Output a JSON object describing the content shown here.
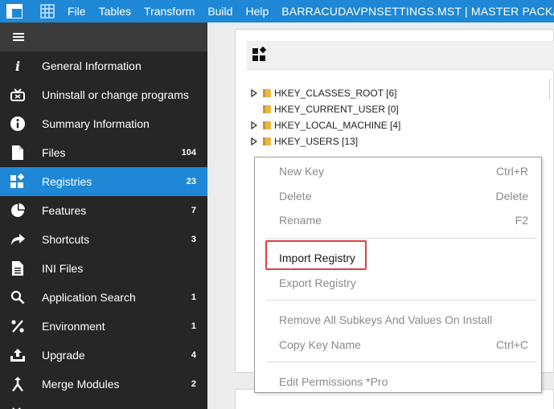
{
  "titlebar": {
    "menu": [
      "File",
      "Tables",
      "Transform",
      "Build",
      "Help"
    ],
    "title": "BARRACUDAVPNSETTINGS.MST | MASTER PACKAG"
  },
  "sidebar": {
    "items": [
      {
        "icon": "info-icon",
        "label": "General Information",
        "count": ""
      },
      {
        "icon": "uninstall-icon",
        "label": "Uninstall or change programs",
        "count": ""
      },
      {
        "icon": "summary-info-icon",
        "label": "Summary Information",
        "count": ""
      },
      {
        "icon": "file-icon",
        "label": "Files",
        "count": "104"
      },
      {
        "icon": "registry-icon",
        "label": "Registries",
        "count": "23"
      },
      {
        "icon": "features-icon",
        "label": "Features",
        "count": "7"
      },
      {
        "icon": "shortcut-icon",
        "label": "Shortcuts",
        "count": "3"
      },
      {
        "icon": "ini-file-icon",
        "label": "INI Files",
        "count": ""
      },
      {
        "icon": "search-icon",
        "label": "Application Search",
        "count": "1"
      },
      {
        "icon": "percent-icon",
        "label": "Environment",
        "count": "1"
      },
      {
        "icon": "upgrade-icon",
        "label": "Upgrade",
        "count": "4"
      },
      {
        "icon": "merge-icon",
        "label": "Merge Modules",
        "count": "2"
      }
    ],
    "active_index": 4
  },
  "tree": [
    {
      "label": "HKEY_CLASSES_ROOT [6]",
      "expandable": true
    },
    {
      "label": "HKEY_CURRENT_USER [0]",
      "expandable": false
    },
    {
      "label": "HKEY_LOCAL_MACHINE [4]",
      "expandable": true
    },
    {
      "label": "HKEY_USERS [13]",
      "expandable": true
    }
  ],
  "context_menu": {
    "new_key": {
      "label": "New Key",
      "shortcut": "Ctrl+R"
    },
    "delete": {
      "label": "Delete",
      "shortcut": "Delete"
    },
    "rename": {
      "label": "Rename",
      "shortcut": "F2"
    },
    "import_registry": {
      "label": "Import Registry"
    },
    "export_registry": {
      "label": "Export Registry"
    },
    "remove_all": {
      "label": "Remove All Subkeys And Values On Install"
    },
    "copy_key_name": {
      "label": "Copy Key Name",
      "shortcut": "Ctrl+C"
    },
    "edit_permissions": {
      "label": "Edit Permissions *Pro"
    }
  },
  "colors": {
    "accent": "#1e88d6",
    "sidebar": "#262626",
    "highlight": "#e0403f"
  }
}
